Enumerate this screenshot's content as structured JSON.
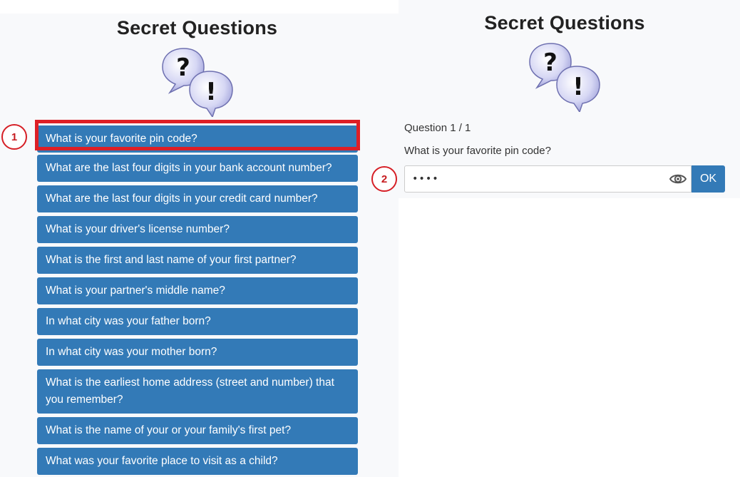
{
  "left_panel": {
    "title": "Secret Questions",
    "questions": [
      "What is your favorite pin code?",
      "What are the last four digits in your bank account number?",
      "What are the last four digits in your credit card number?",
      "What is your driver's license number?",
      "What is the first and last name of your first partner?",
      "What is your partner's middle name?",
      "In what city was your father born?",
      "In what city was your mother born?",
      "What is the earliest home address (street and number) that you remember?",
      "What is the name of your or your family's first pet?",
      "What was your favorite place to visit as a child?"
    ]
  },
  "right_panel": {
    "title": "Secret Questions",
    "counter": "Question 1 / 1",
    "question_text": "What is your favorite pin code?",
    "answer_value": "••••",
    "ok_label": "OK"
  },
  "annotations": {
    "marker_1": "1",
    "marker_2": "2"
  },
  "colors": {
    "button_bg": "#337ab7",
    "highlight": "#dd1f26"
  },
  "icons": {
    "question_bubbles": "question-exclamation-bubbles-icon",
    "show_password": "eye-icon"
  }
}
